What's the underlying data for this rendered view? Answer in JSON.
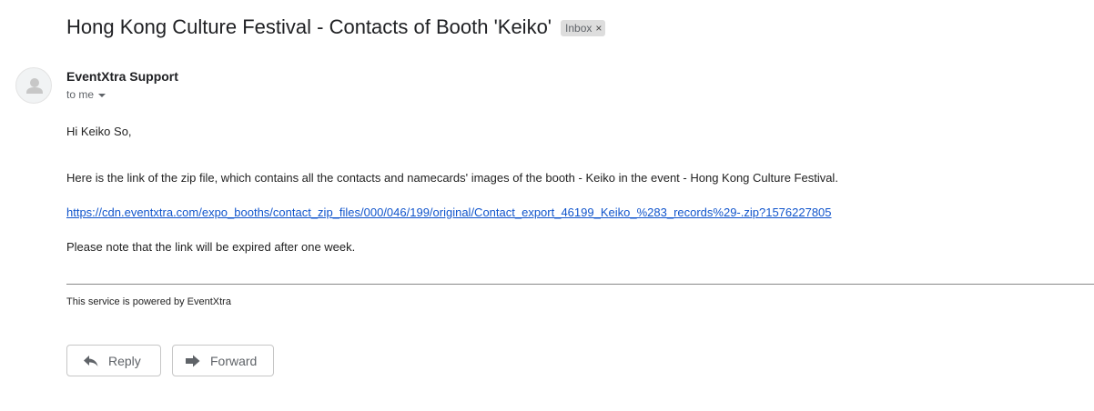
{
  "email": {
    "subject": "Hong Kong Culture Festival - Contacts of Booth 'Keiko'",
    "label": "Inbox",
    "label_close": "×",
    "sender": "EventXtra Support",
    "recipients": "to me",
    "greeting": "Hi Keiko So,",
    "paragraph_1": "Here is the link of the zip file, which contains all the contacts and namecards' images of the booth - Keiko in the event - Hong Kong Culture Festival.",
    "link": "https://cdn.eventxtra.com/expo_booths/contact_zip_files/000/046/199/original/Contact_export_46199_Keiko_%283_records%29-.zip?1576227805",
    "paragraph_2": "Please note that the link will be expired after one week.",
    "footer": "This service is powered by EventXtra"
  },
  "actions": {
    "reply_label": "Reply",
    "forward_label": "Forward"
  },
  "icons": {
    "avatar": "person-avatar-icon",
    "reply": "reply-arrow-icon",
    "forward": "forward-arrow-icon",
    "dropdown": "chevron-down-icon"
  },
  "colors": {
    "link": "#1155cc",
    "label_chip": "#dddddd",
    "secondary_text": "#5f6368"
  }
}
